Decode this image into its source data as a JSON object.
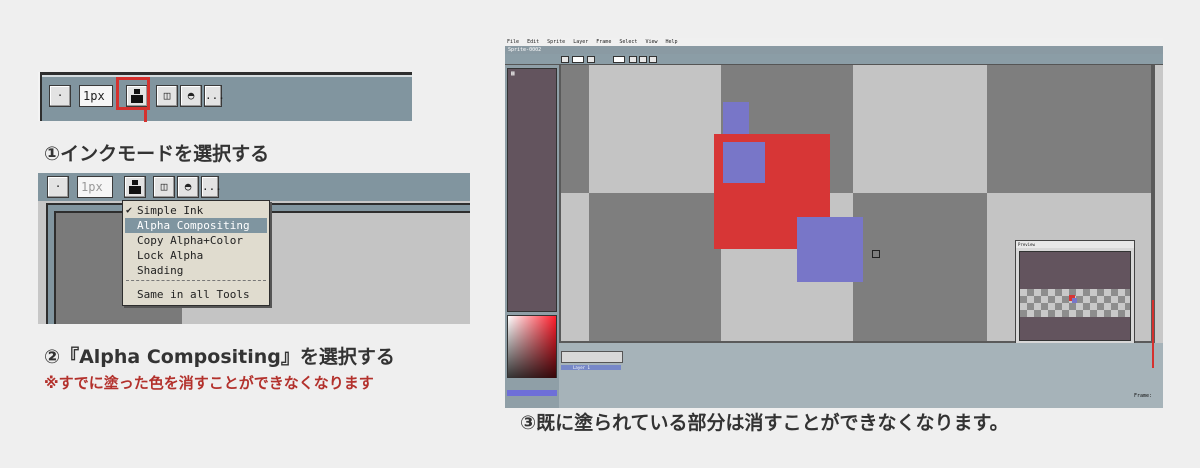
{
  "panel1": {
    "dot_label": "·",
    "brush_size_value": "1px",
    "more_label": "..."
  },
  "caption1": "①インクモードを選択する",
  "panel2": {
    "dot_label": "·",
    "brush_size_value": "1px",
    "more_label": "...",
    "menu_items": [
      {
        "label": "Simple Ink",
        "checked": true,
        "selected": false
      },
      {
        "label": "Alpha Compositing",
        "checked": false,
        "selected": true
      },
      {
        "label": "Copy Alpha+Color",
        "checked": false,
        "selected": false
      },
      {
        "label": "Lock Alpha",
        "checked": false,
        "selected": false
      },
      {
        "label": "Shading",
        "checked": false,
        "selected": false
      },
      {
        "label": "Same in all Tools",
        "checked": false,
        "selected": false
      }
    ]
  },
  "caption2": "②『Alpha Compositing』を選択する",
  "warning": "※すでに塗った色を消すことができなくなります",
  "panel3": {
    "menubar": [
      "File",
      "Edit",
      "Sprite",
      "Layer",
      "Frame",
      "Select",
      "View",
      "Help"
    ],
    "tab_name": "Sprite-0002",
    "layer_name": "Layer 1",
    "frame_label": "Frame:",
    "preview_title": "Preview"
  },
  "caption3": "③既に塗られている部分は消すことができなくなります。",
  "colors": {
    "highlight_red": "#d5312e",
    "caption_text": "#333333",
    "warning_text": "#b3312c",
    "paint_red": "#d73636",
    "paint_blue": "#7876c8",
    "ui_steel": "#81959f"
  }
}
